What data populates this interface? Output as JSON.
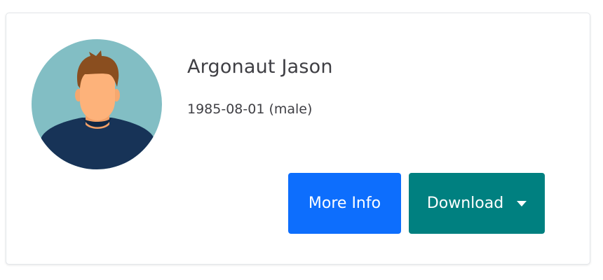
{
  "profile": {
    "name": "Argonaut Jason",
    "birth_info": "1985-08-01 (male)"
  },
  "actions": {
    "more_info_label": "More Info",
    "download_label": "Download"
  },
  "icons": {
    "avatar": "male-avatar-icon",
    "dropdown": "caret-down-icon"
  },
  "colors": {
    "more_info_bg": "#0d6efd",
    "download_bg": "#008080",
    "avatar_bg": "#82bec4",
    "shirt": "#173357"
  }
}
